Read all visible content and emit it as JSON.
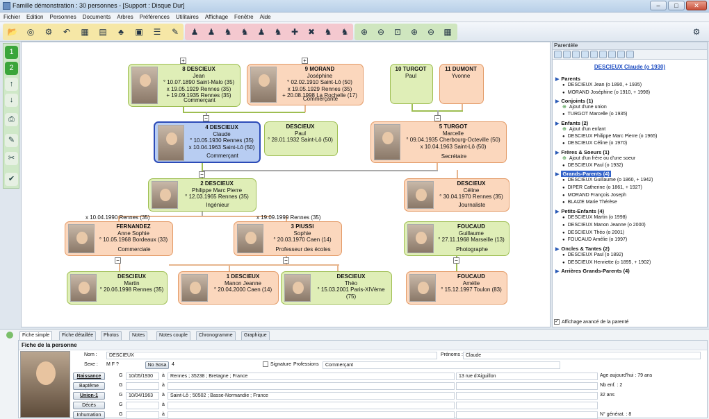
{
  "window": {
    "title": "Famille démonstration : 30 personnes - [Support : Disque Dur]",
    "min": "–",
    "max": "□",
    "close": "✕"
  },
  "menu": [
    "Fichier",
    "Edition",
    "Personnes",
    "Documents",
    "Arbres",
    "Préférences",
    "Utilitaires",
    "Affichage",
    "Fenêtre",
    "Aide"
  ],
  "toolbar_icons": [
    "open-folder-icon",
    "globe-icon",
    "tree-search-icon",
    "undo-icon",
    "print-icon",
    "book-icon",
    "tree-icon",
    "document-icon",
    "list-icon",
    "pen-icon",
    "person-a-icon",
    "person-b-icon",
    "couple-icon",
    "people-icon",
    "person-c-icon",
    "people-b-icon",
    "add-person-icon",
    "remove-person-icon",
    "people-c-icon",
    "people-d-icon",
    "zoom-in-icon",
    "zoom-out-icon",
    "zoom-fit-icon",
    "zoom-a-icon",
    "zoom-b-icon",
    "grid-icon",
    "settings-icon"
  ],
  "left_tools": [
    "1",
    "2",
    "↑",
    "↓",
    "⎙",
    "✎",
    "✂",
    "✔"
  ],
  "persons": [
    {
      "id": "p8",
      "name": "8 DESCIEUX",
      "first": "Jean",
      "l1": "° 10.07.1890 Saint-Malo (35)",
      "l2": "x 19.05.1929 Rennes (35)",
      "l3": "+ 19.09.1935 Rennes (35)",
      "prof": "Commerçant"
    },
    {
      "id": "p9",
      "name": "9 MORAND",
      "first": "Joséphine",
      "l1": "° 02.02.1910 Saint-Lô (50)",
      "l2": "x 19.05.1929 Rennes (35)",
      "l3": "+ 20.08.1998 La Rochelle (17)",
      "prof": "Commerçante"
    },
    {
      "id": "p10",
      "name": "10 TURGOT",
      "first": "Paul"
    },
    {
      "id": "p11",
      "name": "11 DUMONT",
      "first": "Yvonne"
    },
    {
      "id": "p4",
      "name": "4 DESCIEUX",
      "first": "Claude",
      "l1": "° 10.05.1930 Rennes (35)",
      "l2": "x 10.04.1963 Saint-Lô (50)",
      "prof": "Commerçant"
    },
    {
      "id": "pPaul",
      "name": "DESCIEUX",
      "first": "Paul",
      "l1": "° 28.01.1932 Saint-Lô (50)"
    },
    {
      "id": "p5",
      "name": "5 TURGOT",
      "first": "Marcelle",
      "l1": "° 09.04.1935 Cherbourg-Octeville (50)",
      "l2": "x 10.04.1963 Saint-Lô (50)",
      "prof": "Secrétaire"
    },
    {
      "id": "p2",
      "name": "2 DESCIEUX",
      "first": "Philippe Marc Pierre",
      "l1": "° 12.03.1965 Rennes (35)",
      "prof": "Ingénieur"
    },
    {
      "id": "pCeline",
      "name": "DESCIEUX",
      "first": "Céline",
      "l1": "° 30.04.1970 Rennes (35)",
      "prof": "Journaliste"
    },
    {
      "id": "pFern",
      "name": "FERNANDEZ",
      "first": "Anne Sophie",
      "l1": "° 10.05.1968 Bordeaux (33)",
      "prof": "Commerciale"
    },
    {
      "id": "p3",
      "name": "3 PIUSSI",
      "first": "Sophie",
      "l1": "° 20.03.1970 Caen (14)",
      "prof": "Professeur des écoles"
    },
    {
      "id": "pFouG",
      "name": "FOUCAUD",
      "first": "Guillaume",
      "l1": "° 27.11.1968 Marseille (13)",
      "prof": "Photographe"
    },
    {
      "id": "pMartin",
      "name": "DESCIEUX",
      "first": "Martin",
      "l1": "° 20.06.1998 Rennes (35)"
    },
    {
      "id": "p1",
      "name": "1 DESCIEUX",
      "first": "Manon Jeanne",
      "l1": "° 20.04.2000 Caen (14)"
    },
    {
      "id": "pTheo",
      "name": "DESCIEUX",
      "first": "Théo",
      "l1": "° 15.03.2001 Paris-XIVème (75)"
    },
    {
      "id": "pFouA",
      "name": "FOUCAUD",
      "first": "Amélie",
      "l1": "° 15.12.1997 Toulon (83)"
    }
  ],
  "marriage_labels": {
    "left": "x 10.04.1990 Rennes (35)",
    "right": "x 19.09.1999 Rennes (35)"
  },
  "parente": {
    "title": "Parentèle",
    "focus": "DESCIEUX Claude (o 1930)",
    "sections": [
      {
        "label": "Parents",
        "items": [
          "DESCIEUX Jean (o 1890, + 1935)",
          "MORAND Joséphine (o 1910, + 1998)"
        ]
      },
      {
        "label": "Conjoints (1)",
        "items": [
          "+Ajout d'une union",
          "TURGOT Marcelle (o 1935)"
        ]
      },
      {
        "label": "Enfants (2)",
        "items": [
          "+Ajout d'un enfant",
          "DESCIEUX Philippe Marc Pierre (o 1965)",
          "DESCIEUX Céline (o 1970)"
        ]
      },
      {
        "label": "Frères & Soeurs (1)",
        "items": [
          "+Ajout d'un frère ou d'une soeur",
          "DESCIEUX Paul (o 1932)"
        ]
      },
      {
        "label": "Grands-Parents (4)",
        "hl": true,
        "items": [
          "DESCIEUX Guillaume (o 1860, + 1942)",
          "DIPER Catherine (o 1861, + 1927)",
          "MORAND François Joseph",
          "BLAIZE Marie Thérèse"
        ]
      },
      {
        "label": "Petits-Enfants (4)",
        "items": [
          "DESCIEUX Martin (o 1998)",
          "DESCIEUX Manon Jeanne (o 2000)",
          "DESCIEUX Théo (o 2001)",
          "FOUCAUD Amélie (o 1997)"
        ]
      },
      {
        "label": "Oncles & Tantes (2)",
        "items": [
          "DESCIEUX Paul (o 1892)",
          "DESCIEUX Henriette (o 1895, + 1902)"
        ]
      },
      {
        "label": "Arrières Grands-Parents (4)",
        "items": []
      }
    ],
    "advanced": "Affichage avancé de la parenté"
  },
  "tabs": [
    "Fiche simple",
    "Fiche détaillée",
    "Photos",
    "Notes",
    "Notes couple",
    "Chronogramme",
    "Graphique"
  ],
  "fiche": {
    "header": "Fiche de la personne",
    "nom_label": "Nom :",
    "nom": "DESCIEUX",
    "prenoms_label": "Prénoms :",
    "prenoms": "Claude",
    "sexe_label": "Sexe :",
    "sexe_opts": "M  F  ?",
    "nososa_btn": "No Sosa",
    "nososa": "4",
    "signature": "Signature",
    "professions_label": "Professions",
    "profession": "Commerçant",
    "events": [
      {
        "label": "Naissance",
        "u": true,
        "g": "G",
        "date": "10/05/1930",
        "a": "à",
        "place": "Rennes ; 35238 ; Bretagne ; France",
        "extra": "13 rue d'Aiguillon",
        "info": "Age aujourd'hui : 79 ans"
      },
      {
        "label": "Baptême",
        "u": false,
        "g": "G",
        "date": "",
        "a": "à",
        "place": "",
        "extra": "",
        "info": "Nb enf. : 2"
      },
      {
        "label": "Union-1",
        "u": true,
        "g": "G",
        "date": "10/04/1963",
        "a": "à",
        "place": "Saint-Lô ; 50502 ; Basse-Normandie ; France",
        "extra": "",
        "info": "32 ans"
      },
      {
        "label": "Décès",
        "u": false,
        "g": "G",
        "date": "",
        "a": "à",
        "place": "",
        "extra": "",
        "info": ""
      },
      {
        "label": "Inhumation",
        "u": false,
        "g": "G",
        "date": "",
        "a": "à",
        "place": "",
        "extra": "",
        "info": "N° générat. : 8"
      }
    ]
  }
}
